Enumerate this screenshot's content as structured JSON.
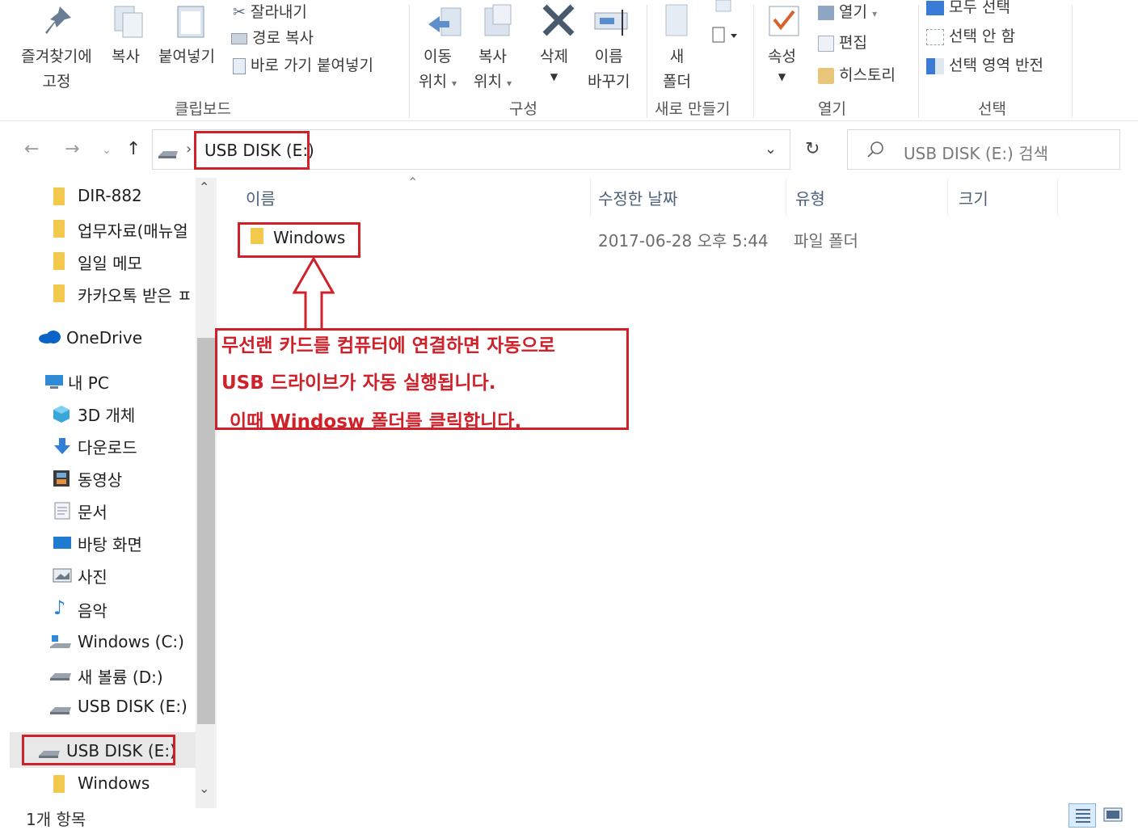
{
  "ribbon": {
    "clipboard": {
      "pin_label_1": "즐겨찾기에",
      "pin_label_2": "고정",
      "copy_label": "복사",
      "paste_label": "붙여넣기",
      "cut_label": "잘라내기",
      "copy_path_label": "경로 복사",
      "paste_shortcut_label": "바로 가기 붙여넣기",
      "group_label": "클립보드"
    },
    "organize": {
      "move_to_1": "이동",
      "move_to_2": "위치",
      "copy_to_1": "복사",
      "copy_to_2": "위치",
      "delete_label": "삭제",
      "rename_1": "이름",
      "rename_2": "바꾸기",
      "group_label": "구성"
    },
    "new": {
      "new_folder_1": "새",
      "new_folder_2": "폴더",
      "group_label": "새로 만들기"
    },
    "open": {
      "properties_label": "속성",
      "open_label": "열기",
      "edit_label": "편집",
      "history_label": "히스토리",
      "group_label": "열기"
    },
    "select": {
      "select_all_label": "모두 선택",
      "select_none_label": "선택 안 함",
      "invert_label": "선택 영역 반전",
      "group_label": "선택"
    }
  },
  "address": {
    "path": "USB DISK (E:)",
    "search_placeholder": "USB DISK (E:) 검색"
  },
  "sidebar": {
    "quick": [
      "DIR-882",
      "업무자료(매뉴얼",
      "일일 메모",
      "카카오톡 받은 ㅍ"
    ],
    "onedrive": "OneDrive",
    "thispc": "내 PC",
    "pc_items": [
      "3D 개체",
      "다운로드",
      "동영상",
      "문서",
      "바탕 화면",
      "사진",
      "음악",
      "Windows (C:)",
      "새 볼륨 (D:)",
      "USB DISK (E:)"
    ],
    "usb": "USB DISK (E:)",
    "usb_child": "Windows"
  },
  "columns": {
    "name": "이름",
    "date": "수정한 날짜",
    "type": "유형",
    "size": "크기"
  },
  "files": [
    {
      "name": "Windows",
      "date": "2017-06-28 오후 5:44",
      "type": "파일 폴더",
      "size": ""
    }
  ],
  "annotation": {
    "line1": "무선랜 카드를 컴퓨터에 연결하면 자동으로",
    "line2": "USB 드라이브가 자동 실행됩니다.",
    "line3": "이때 Windosw 폴더를 클릭합니다."
  },
  "status": {
    "count": "1개 항목"
  },
  "colors": {
    "accent_red": "#d0202a",
    "folder_yellow": "#f2c94c",
    "header_text": "#4c607a"
  }
}
